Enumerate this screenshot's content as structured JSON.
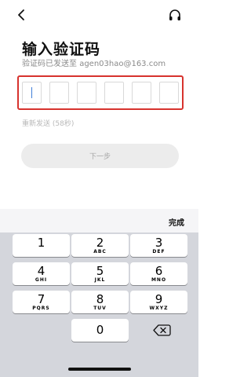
{
  "header": {
    "back_icon": "chevron-left-icon",
    "support_icon": "headphones-icon"
  },
  "title": "输入验证码",
  "subtitle": {
    "prefix": "验证码已发送至 ",
    "email": "agen03hao@163.com"
  },
  "code_input": {
    "length": 6,
    "values": [
      "",
      "",
      "",
      "",
      "",
      ""
    ],
    "focused_index": 0
  },
  "colors": {
    "highlight_border": "#d7332e",
    "caret": "#3f7dd8",
    "button_bg": "#ececec"
  },
  "resend": "重新发送 (58秒)",
  "next_button": "下一步",
  "keyboard": {
    "done": "完成",
    "keys": [
      {
        "num": "1",
        "letters": ""
      },
      {
        "num": "2",
        "letters": "ABC"
      },
      {
        "num": "3",
        "letters": "DEF"
      },
      {
        "num": "4",
        "letters": "GHI"
      },
      {
        "num": "5",
        "letters": "JKL"
      },
      {
        "num": "6",
        "letters": "MNO"
      },
      {
        "num": "7",
        "letters": "PQRS"
      },
      {
        "num": "8",
        "letters": "TUV"
      },
      {
        "num": "9",
        "letters": "WXYZ"
      },
      {
        "num": "0",
        "letters": ""
      }
    ],
    "backspace_icon": "backspace-icon"
  }
}
